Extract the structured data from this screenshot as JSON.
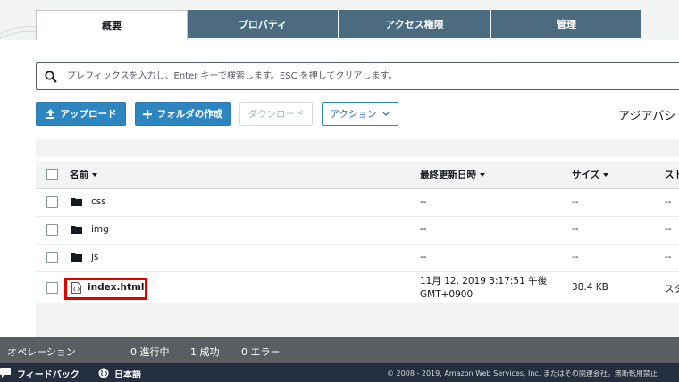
{
  "tabs": [
    {
      "label": "概要",
      "active": true
    },
    {
      "label": "プロパティ",
      "active": false
    },
    {
      "label": "アクセス権限",
      "active": false
    },
    {
      "label": "管理",
      "active": false
    }
  ],
  "search": {
    "placeholder": "プレフィックスを入力し、Enter キーで検索します。ESC を押してクリアします。",
    "icon": "search-icon"
  },
  "toolbar": {
    "upload": "アップロード",
    "create_folder": "フォルダの作成",
    "download": "ダウンロード",
    "actions": "アクション"
  },
  "region": "アジアパシ",
  "table": {
    "headers": {
      "name": "名前",
      "modified": "最終更新日時",
      "size": "サイズ",
      "storage": "スト"
    },
    "rows": [
      {
        "name": "css",
        "modified": "--",
        "size": "--",
        "storage": "--",
        "type": "folder"
      },
      {
        "name": "img",
        "modified": "--",
        "size": "--",
        "storage": "--",
        "type": "folder"
      },
      {
        "name": "js",
        "modified": "--",
        "size": "--",
        "storage": "--",
        "type": "folder"
      },
      {
        "name": "index.html",
        "modified_line1": "11月 12, 2019 3:17:51 午後",
        "modified_line2": "GMT+0900",
        "size": "38.4 KB",
        "storage": "スタ",
        "type": "file"
      }
    ]
  },
  "operations": {
    "label": "オペレーション",
    "in_progress": "0 進行中",
    "success": "1 成功",
    "errors": "0 エラー"
  },
  "footer": {
    "feedback": "フィードバック",
    "language": "日本語",
    "copyright": "© 2008 - 2019, Amazon Web Services, Inc. またはその関連会社。無断転用禁止"
  },
  "colors": {
    "tab_inactive": "#4b6b80",
    "primary": "#2e86c1",
    "highlight": "#e00000",
    "footer": "#232f3e",
    "opbar": "#5a5e63"
  }
}
